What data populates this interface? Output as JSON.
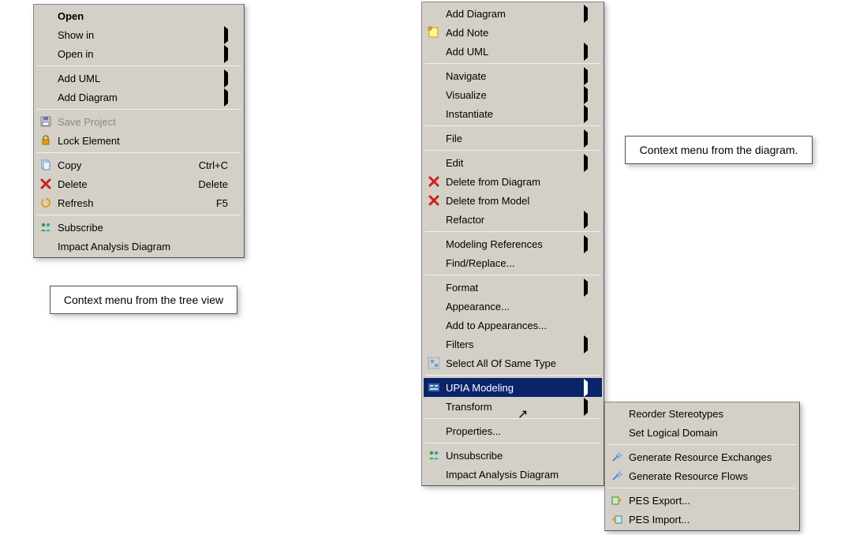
{
  "cursor_glyph": "↖",
  "left_menu": {
    "groups": [
      [
        {
          "name": "open",
          "label": "Open",
          "bold": true,
          "icon": null,
          "submenu": false
        },
        {
          "name": "show-in",
          "label": "Show in",
          "icon": null,
          "submenu": true
        },
        {
          "name": "open-in",
          "label": "Open in",
          "icon": null,
          "submenu": true
        }
      ],
      [
        {
          "name": "add-uml",
          "label": "Add UML",
          "icon": null,
          "submenu": true
        },
        {
          "name": "add-diagram",
          "label": "Add Diagram",
          "icon": null,
          "submenu": true
        }
      ],
      [
        {
          "name": "save-project",
          "label": "Save Project",
          "icon": "floppy",
          "disabled": true
        },
        {
          "name": "lock-element",
          "label": "Lock Element",
          "icon": "lock"
        }
      ],
      [
        {
          "name": "copy",
          "label": "Copy",
          "icon": "copy",
          "accel": "Ctrl+C"
        },
        {
          "name": "delete",
          "label": "Delete",
          "icon": "x-red",
          "accel": "Delete"
        },
        {
          "name": "refresh",
          "label": "Refresh",
          "icon": "refresh",
          "accel": "F5"
        }
      ],
      [
        {
          "name": "subscribe",
          "label": "Subscribe",
          "icon": "people"
        },
        {
          "name": "impact-analysis",
          "label": "Impact Analysis Diagram",
          "icon": null
        }
      ]
    ]
  },
  "left_callout": "Context menu from the tree view",
  "center_menu": {
    "groups": [
      [
        {
          "name": "add-diagram",
          "label": "Add Diagram",
          "icon": null,
          "submenu": true
        },
        {
          "name": "add-note",
          "label": "Add Note",
          "icon": "note"
        },
        {
          "name": "add-uml",
          "label": "Add UML",
          "icon": null,
          "submenu": true
        }
      ],
      [
        {
          "name": "navigate",
          "label": "Navigate",
          "icon": null,
          "submenu": true
        },
        {
          "name": "visualize",
          "label": "Visualize",
          "icon": null,
          "submenu": true
        },
        {
          "name": "instantiate",
          "label": "Instantiate",
          "icon": null,
          "submenu": true
        }
      ],
      [
        {
          "name": "file",
          "label": "File",
          "icon": null,
          "submenu": true
        }
      ],
      [
        {
          "name": "edit",
          "label": "Edit",
          "icon": null,
          "submenu": true
        },
        {
          "name": "delete-from-diagram",
          "label": "Delete from Diagram",
          "icon": "x-red"
        },
        {
          "name": "delete-from-model",
          "label": "Delete from Model",
          "icon": "x-red"
        },
        {
          "name": "refactor",
          "label": "Refactor",
          "icon": null,
          "submenu": true
        }
      ],
      [
        {
          "name": "modeling-references",
          "label": "Modeling References",
          "icon": null,
          "submenu": true
        },
        {
          "name": "find-replace",
          "label": "Find/Replace...",
          "icon": null
        }
      ],
      [
        {
          "name": "format",
          "label": "Format",
          "icon": null,
          "submenu": true
        },
        {
          "name": "appearance",
          "label": "Appearance...",
          "icon": null
        },
        {
          "name": "add-to-appearances",
          "label": "Add to Appearances...",
          "icon": null
        },
        {
          "name": "filters",
          "label": "Filters",
          "icon": null,
          "submenu": true
        },
        {
          "name": "select-all-same-type",
          "label": "Select All Of Same Type",
          "icon": "select-all"
        }
      ],
      [
        {
          "name": "upia-modeling",
          "label": "UPIA Modeling",
          "icon": "upia",
          "submenu": true,
          "highlight": true
        },
        {
          "name": "transform",
          "label": "Transform",
          "icon": null,
          "submenu": true
        }
      ],
      [
        {
          "name": "properties",
          "label": "Properties...",
          "icon": null
        }
      ],
      [
        {
          "name": "unsubscribe",
          "label": "Unsubscribe",
          "icon": "people"
        },
        {
          "name": "impact-analysis",
          "label": "Impact Analysis Diagram",
          "icon": null
        }
      ]
    ]
  },
  "right_callout": "Context menu from the diagram.",
  "submenu": {
    "groups": [
      [
        {
          "name": "reorder-stereotypes",
          "label": "Reorder Stereotypes",
          "icon": null
        },
        {
          "name": "set-logical-domain",
          "label": "Set Logical Domain",
          "icon": null
        }
      ],
      [
        {
          "name": "generate-resource-exchanges",
          "label": "Generate Resource Exchanges",
          "icon": "wand"
        },
        {
          "name": "generate-resource-flows",
          "label": "Generate Resource Flows",
          "icon": "wand"
        }
      ],
      [
        {
          "name": "pes-export",
          "label": "PES Export...",
          "icon": "pes-export"
        },
        {
          "name": "pes-import",
          "label": "PES Import...",
          "icon": "pes-import"
        }
      ]
    ]
  }
}
